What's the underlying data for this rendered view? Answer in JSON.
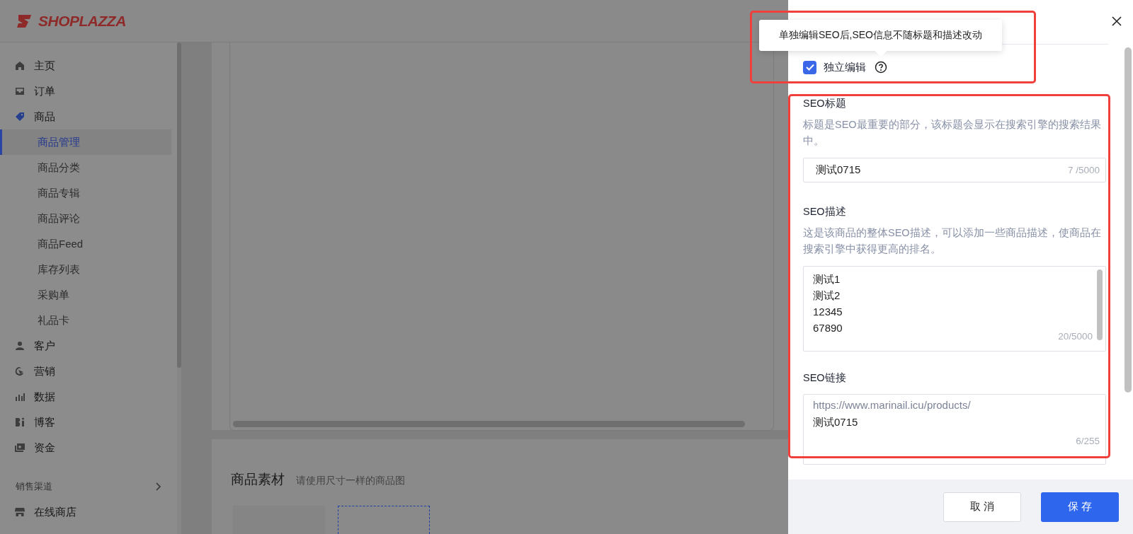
{
  "logo": {
    "text": "SHOPLAZZA"
  },
  "sidebar": {
    "items": [
      {
        "label": "主页",
        "selected": false
      },
      {
        "label": "订单",
        "selected": false
      },
      {
        "label": "商品",
        "selected": false,
        "children": [
          {
            "label": "商品管理",
            "selected": true
          },
          {
            "label": "商品分类",
            "selected": false
          },
          {
            "label": "商品专辑",
            "selected": false
          },
          {
            "label": "商品评论",
            "selected": false
          },
          {
            "label": "商品Feed",
            "selected": false
          },
          {
            "label": "库存列表",
            "selected": false
          },
          {
            "label": "采购单",
            "selected": false
          },
          {
            "label": "礼品卡",
            "selected": false
          }
        ]
      },
      {
        "label": "客户",
        "selected": false
      },
      {
        "label": "营销",
        "selected": false
      },
      {
        "label": "数据",
        "selected": false
      },
      {
        "label": "博客",
        "selected": false
      },
      {
        "label": "资金",
        "selected": false
      }
    ],
    "section": {
      "label": "销售渠道"
    },
    "channel_items": [
      {
        "label": "在线商店",
        "selected": false
      }
    ]
  },
  "main": {
    "media_section": {
      "title": "商品素材",
      "hint": "请使用尺寸一样的商品图"
    }
  },
  "drawer": {
    "tooltip": "单独编辑SEO后,SEO信息不随标题和描述改动",
    "independent_edit": {
      "label": "独立编辑",
      "checked": true
    },
    "seo_title": {
      "label": "SEO标题",
      "help": "标题是SEO最重要的部分，该标题会显示在搜索引擎的搜索结果中。",
      "value": "测试0715",
      "counter": "7 /5000"
    },
    "seo_description": {
      "label": "SEO描述",
      "help": "这是该商品的整体SEO描述，可以添加一些商品描述，使商品在搜索引擎中获得更高的排名。",
      "value": "测试1\n测试2\n12345\n67890",
      "counter": "20/5000"
    },
    "seo_link": {
      "label": "SEO链接",
      "prefix": "https://www.marinail.icu/products/",
      "value": "测试0715",
      "counter": "6/255"
    },
    "buttons": [
      {
        "label": "取 消",
        "kind": "secondary"
      },
      {
        "label": "保 存",
        "kind": "primary"
      }
    ]
  }
}
